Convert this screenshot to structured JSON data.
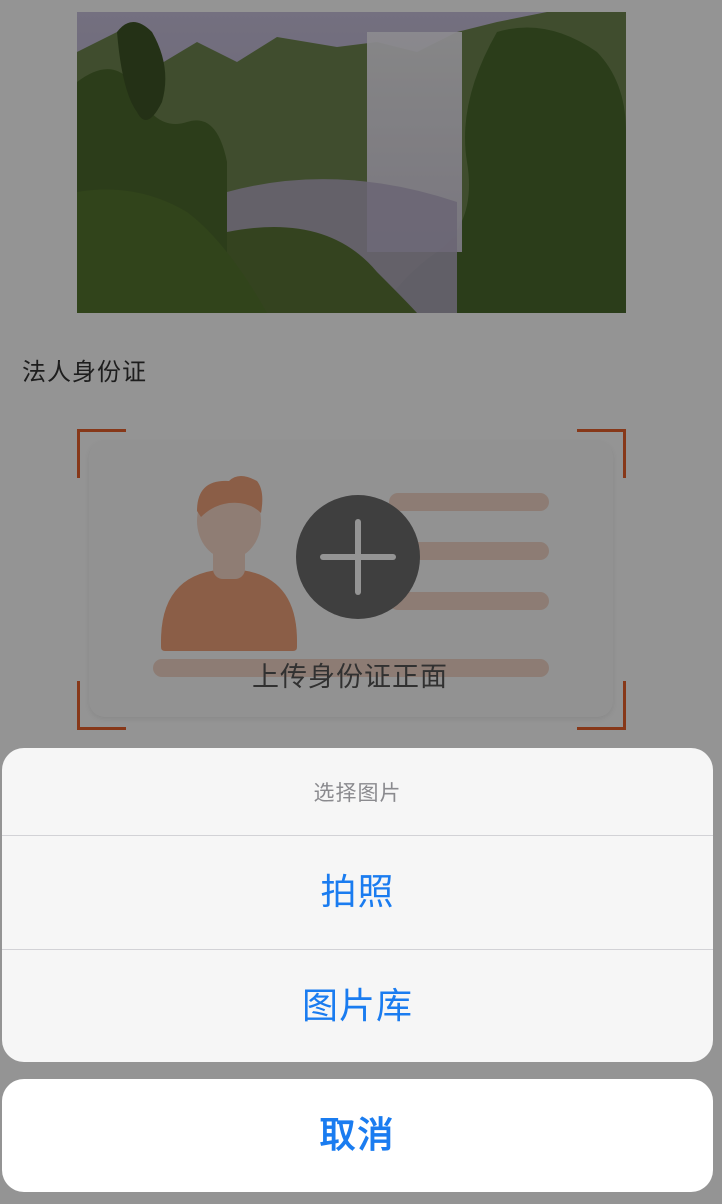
{
  "form": {
    "section_label": "法人身份证",
    "upload_front_label": "上传身份证正面"
  },
  "action_sheet": {
    "title": "选择图片",
    "options": [
      {
        "label": "拍照"
      },
      {
        "label": "图片库"
      }
    ],
    "cancel_label": "取消"
  },
  "colors": {
    "accent": "#e8612c",
    "action_blue": "#1a7cf0",
    "overlay": "rgba(0,0,0,0.42)"
  },
  "icons": {
    "upload": "plus-icon",
    "id_card": "id-card-illustration"
  }
}
